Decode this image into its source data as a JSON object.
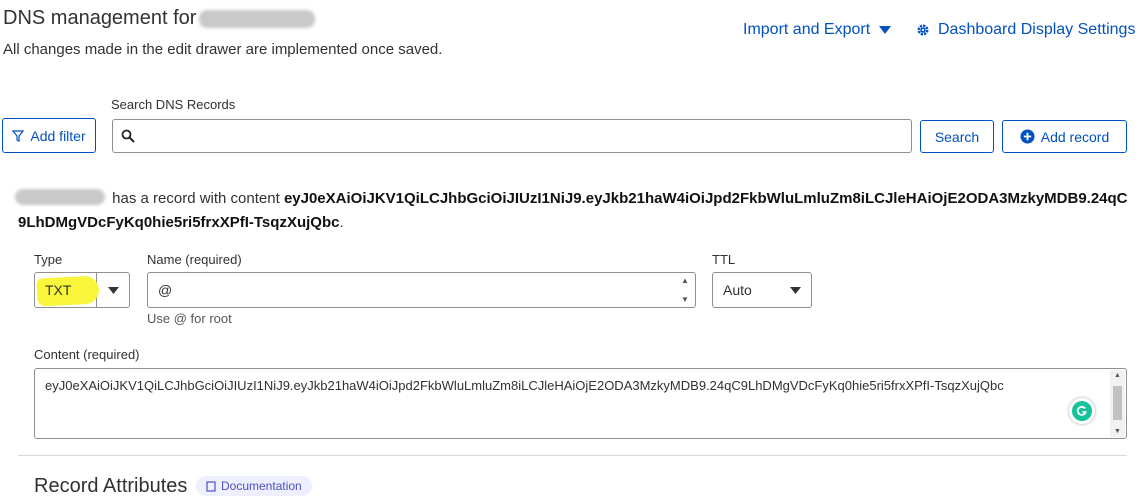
{
  "header": {
    "title_prefix": "DNS management for",
    "subtitle": "All changes made in the edit drawer are implemented once saved.",
    "import_export_label": "Import and Export",
    "dashboard_settings_label": "Dashboard Display Settings"
  },
  "toolbar": {
    "search_label": "Search DNS Records",
    "search_placeholder": "",
    "add_filter_label": "Add filter",
    "search_button_label": "Search",
    "add_record_label": "Add record"
  },
  "record_message": {
    "text_middle": "has a record with content",
    "content": "eyJ0eXAiOiJKV1QiLCJhbGciOiJIUzI1NiJ9.eyJkb21haW4iOiJpd2FkbWluLmluZm8iLCJleHAiOjE2ODA3MzkyMDB9.24qC9LhDMgVDcFyKq0hie5ri5frxXPfI-TsqzXujQbc",
    "end": "."
  },
  "form": {
    "type_label": "Type",
    "type_value": "TXT",
    "name_label": "Name (required)",
    "name_value": "@",
    "name_help": "Use @ for root",
    "ttl_label": "TTL",
    "ttl_value": "Auto",
    "content_label": "Content (required)",
    "content_value": "eyJ0eXAiOiJKV1QiLCJhbGciOiJIUzI1NiJ9.eyJkb21haW4iOiJpd2FkbWluLmluZm8iLCJleHAiOjE2ODA3MzkyMDB9.24qC9LhDMgVDcFyKq0hie5ri5frxXPfI-TsqzXujQbc"
  },
  "section": {
    "heading": "Record Attributes",
    "doc_label": "Documentation"
  },
  "colors": {
    "link": "#0051c3",
    "highlight": "#f8f53a",
    "grammarly": "#15c39a"
  }
}
